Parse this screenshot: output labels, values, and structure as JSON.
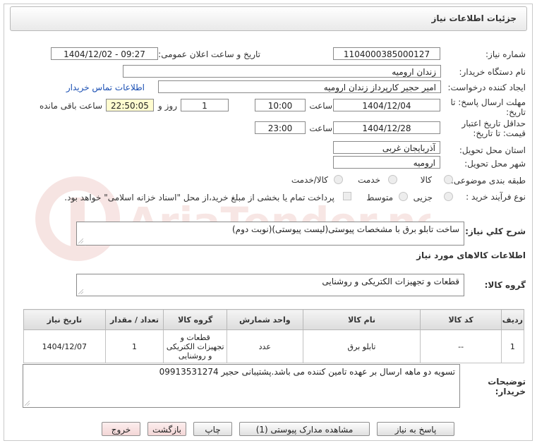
{
  "header": {
    "title": "جزئیات اطلاعات نیاز"
  },
  "form": {
    "need_number_label": "شماره نیاز:",
    "need_number": "1104000385000127",
    "announce_label": "تاریخ و ساعت اعلان عمومی:",
    "announce_value": "1404/12/02 - 09:27",
    "buyer_org_label": "نام دستگاه خریدار:",
    "buyer_org": "زندان ارومیه",
    "creator_label": "ایجاد کننده درخواست:",
    "creator": "امیر حجیر کارپرداز زندان ارومیه",
    "contact_link": "اطلاعات تماس خریدار",
    "deadline_label_1": "مهلت ارسال پاسخ: تا",
    "deadline_label_2": "تاریخ:",
    "deadline_date": "1404/12/04",
    "time_label": "ساعت",
    "deadline_time": "10:00",
    "days_value": "1",
    "days_label": "روز و",
    "remaining_time": "22:50:05",
    "remaining_label": "ساعت باقی مانده",
    "validity_label_1": "حداقل تاریخ اعتبار",
    "validity_label_2": "قیمت: تا تاریخ:",
    "validity_date": "1404/12/28",
    "validity_time": "23:00",
    "province_label": "استان محل تحویل:",
    "province": "آذربایجان غربی",
    "city_label": "شهر محل تحویل:",
    "city": "ارومیه",
    "category_label": "طبقه بندی موضوعی:",
    "category_options": [
      "کالا",
      "خدمت",
      "کالا/خدمت"
    ],
    "process_label": "نوع فرآیند خرید :",
    "process_options": [
      "جزیی",
      "متوسط"
    ],
    "payment_note": "پرداخت تمام یا بخشی از مبلغ خرید،از محل \"اسناد خزانه اسلامی\" خواهد بود."
  },
  "summary": {
    "label": "شرح کلي نياز:",
    "text": "ساخت تابلو برق با مشخصات پیوستی(لیست پیوستی)(نوبت دوم)"
  },
  "goods_info_title": "اطلاعات کالاهای مورد نیاز",
  "goods_group": {
    "label": "گروه کالا:",
    "value": "قطعات و تجهیزات الکتریکی و روشنایی"
  },
  "table": {
    "headers": [
      "ردیف",
      "کد کالا",
      "نام کالا",
      "واحد شمارش",
      "گروه کالا",
      "تعداد / مقدار",
      "تاریخ نیاز"
    ],
    "rows": [
      [
        "1",
        "--",
        "تابلو برق",
        "عدد",
        "قطعات و تجهیزات الکتریکی و روشنایی",
        "1",
        "1404/12/07"
      ]
    ]
  },
  "buyer_notes": {
    "label_1": "توضیحات",
    "label_2": "خریدار:",
    "text": "تسویه دو ماهه ارسال بر عهده تامین کننده می باشد.پشتیبانی حجیر 09913531274"
  },
  "buttons": {
    "reply": "پاسخ به نیاز",
    "view_docs": "مشاهده مدارک پیوستی (1)",
    "print": "چاپ",
    "back": "بازگشت",
    "exit": "خروج"
  },
  "watermark_text": "AriaTender.neT"
}
